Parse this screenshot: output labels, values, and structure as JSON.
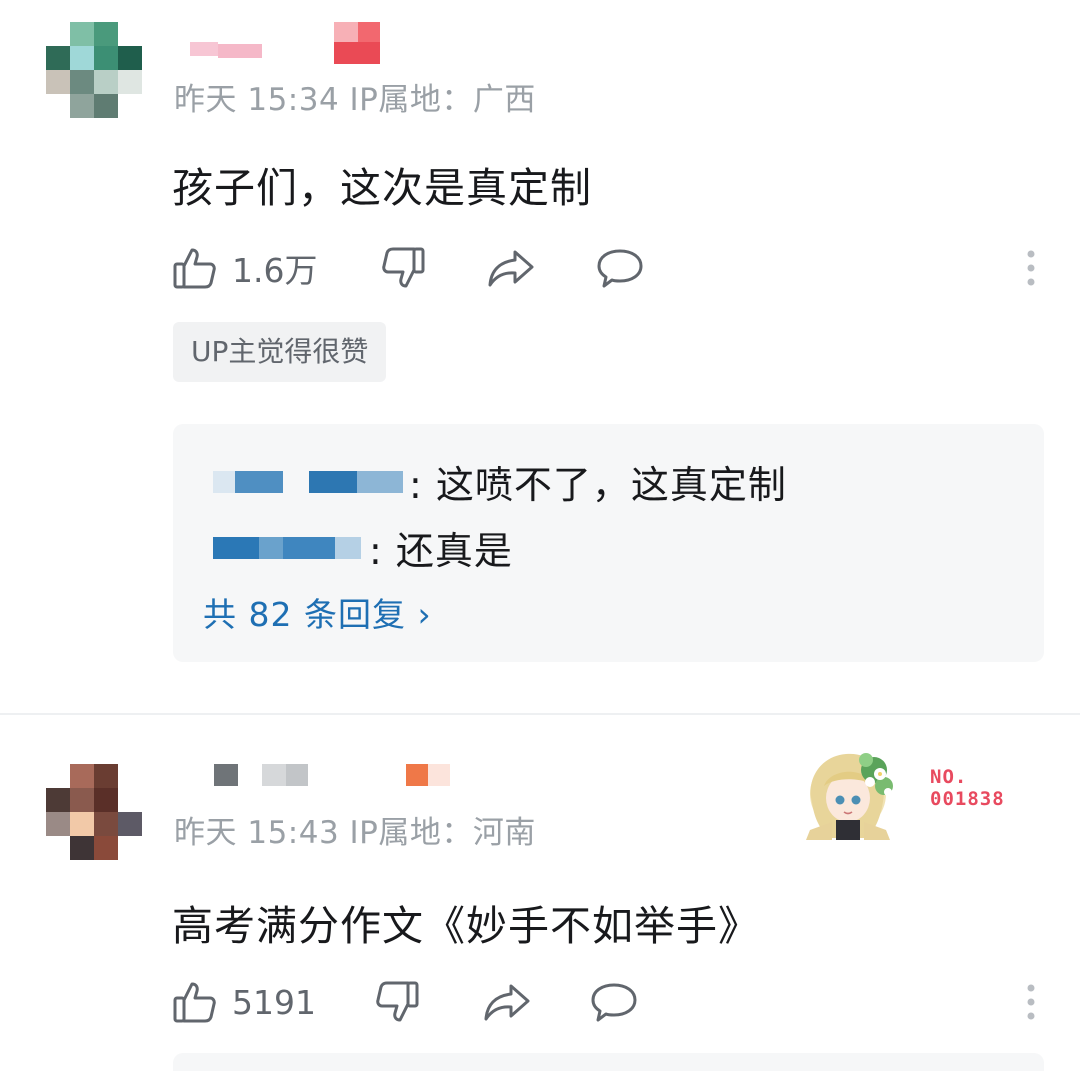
{
  "comments": [
    {
      "meta": "昨天 15:34 IP属地：广西",
      "content": "孩子们，这次是真定制",
      "likes": "1.6万",
      "up_badge": "UP主觉得很赞",
      "replies": [
        {
          "text": ": 这喷不了，这真定制"
        },
        {
          "text": ": 还真是"
        }
      ],
      "reply_count_link": "共 82 条回复 ›"
    },
    {
      "meta": "昨天 15:43 IP属地：河南",
      "content": "高考满分作文《妙手不如举手》",
      "likes": "5191",
      "fan_number": "NO.\n001838"
    }
  ],
  "icons": {
    "like": "thumbs-up-icon",
    "dislike": "thumbs-down-icon",
    "share": "share-arrow-icon",
    "reply": "speech-bubble-icon",
    "more": "vertical-dots-icon"
  },
  "colors": {
    "link": "#1e6fb3",
    "meta": "#9aa0a6",
    "text": "#18191c",
    "fan_number": "#e84a5f"
  }
}
